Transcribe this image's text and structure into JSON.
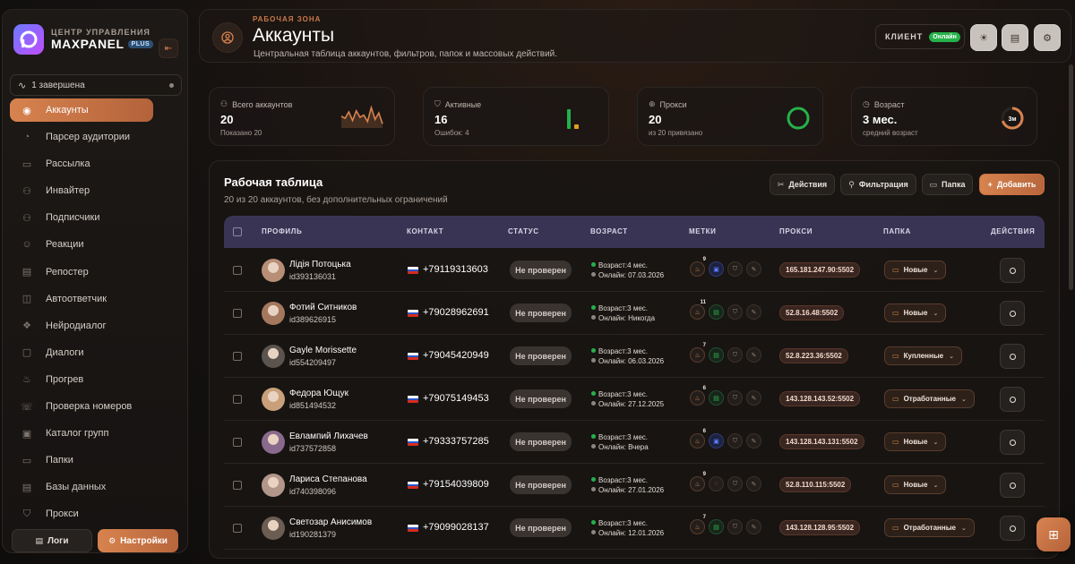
{
  "brand": {
    "subtitle": "ЦЕНТР УПРАВЛЕНИЯ",
    "name": "MAXPANEL",
    "plan": "PLUS"
  },
  "task_status": "1 завершена",
  "sidebar": {
    "items": [
      {
        "label": "Аккаунты",
        "icon": "user-icon",
        "active": true
      },
      {
        "label": "Парсер аудитории",
        "icon": "radar-icon"
      },
      {
        "label": "Рассылка",
        "icon": "mail-icon"
      },
      {
        "label": "Инвайтер",
        "icon": "user-plus-icon"
      },
      {
        "label": "Подписчики",
        "icon": "users-icon"
      },
      {
        "label": "Реакции",
        "icon": "smile-icon"
      },
      {
        "label": "Репостер",
        "icon": "repost-icon"
      },
      {
        "label": "Автоответчик",
        "icon": "bot-icon"
      },
      {
        "label": "Нейродиалог",
        "icon": "brain-icon"
      },
      {
        "label": "Диалоги",
        "icon": "chat-icon"
      },
      {
        "label": "Прогрев",
        "icon": "flame-icon"
      },
      {
        "label": "Проверка номеров",
        "icon": "phone-check-icon"
      },
      {
        "label": "Каталог групп",
        "icon": "catalog-icon"
      },
      {
        "label": "Папки",
        "icon": "folder-icon"
      },
      {
        "label": "Базы данных",
        "icon": "database-icon"
      },
      {
        "label": "Прокси",
        "icon": "shield-icon"
      }
    ],
    "logs_label": "Логи",
    "settings_label": "Настройки"
  },
  "header": {
    "eyebrow": "РАБОЧАЯ ЗОНА",
    "title": "Аккаунты",
    "subtitle": "Центральная таблица аккаунтов, фильтров, папок и массовых действий.",
    "client_label": "КЛИЕНТ",
    "online_label": "Онлайн"
  },
  "stats": [
    {
      "label": "Всего аккаунтов",
      "value": "20",
      "note": "Показано 20",
      "icon": "users-icon"
    },
    {
      "label": "Активные",
      "value": "16",
      "note": "Ошибок: 4",
      "icon": "shield-check-icon"
    },
    {
      "label": "Прокси",
      "value": "20",
      "note": "из 20 привязано",
      "icon": "globe-icon"
    },
    {
      "label": "Возраст",
      "value": "3 мес.",
      "note": "средний возраст",
      "icon": "clock-icon",
      "ring_label": "3м"
    }
  ],
  "stats_visuals": {
    "sparkline": [
      0.55,
      0.45,
      0.75,
      0.35,
      0.8,
      0.5,
      0.6,
      0.3,
      0.95,
      0.4,
      0.7,
      0.2
    ],
    "active_ratio": 0.8,
    "error_ratio": 0.2,
    "proxy_ratio": 1.0,
    "age_ratio": 0.7,
    "colors": {
      "accent": "#d7834f",
      "green": "#25b14a",
      "yellow": "#e0a21e"
    }
  },
  "table": {
    "title": "Рабочая таблица",
    "subtitle": "20 из 20 аккаунтов, без дополнительных ограничений",
    "buttons": {
      "actions": "Действия",
      "filter": "Фильтрация",
      "folder": "Папка",
      "add": "Добавить"
    },
    "columns": {
      "profile": "ПРОФИЛЬ",
      "contact": "КОНТАКТ",
      "status": "СТАТУС",
      "age": "ВОЗРАСТ",
      "tags": "МЕТКИ",
      "proxy": "ПРОКСИ",
      "folder": "ПАПКА",
      "actions": "ДЕЙСТВИЯ"
    },
    "rows": [
      {
        "name": "Лідія Потоцька",
        "id": "id393136031",
        "phone": "+79119313603",
        "status": "Не проверен",
        "age": "Возраст:4 мес.",
        "online": "Онлайн: 07.03.2026",
        "tag_count": "9",
        "second_tag": "bot",
        "proxy": "165.181.247.90:5502",
        "folder": "Новые",
        "avatar_color": "#b88f76"
      },
      {
        "name": "Фотий Ситников",
        "id": "id389626915",
        "phone": "+79028962691",
        "status": "Не проверен",
        "age": "Возраст:3 мес.",
        "online": "Онлайн: Никогда",
        "tag_count": "11",
        "second_tag": "green",
        "proxy": "52.8.16.48:5502",
        "folder": "Новые",
        "avatar_color": "#a4785e"
      },
      {
        "name": "Gayle Morissette",
        "id": "id554209497",
        "phone": "+79045420949",
        "status": "Не проверен",
        "age": "Возраст:3 мес.",
        "online": "Онлайн: 06.03.2026",
        "tag_count": "7",
        "second_tag": "green",
        "proxy": "52.8.223.36:5502",
        "folder": "Купленные",
        "avatar_color": "#5a534e"
      },
      {
        "name": "Федора Ющук",
        "id": "id851494532",
        "phone": "+79075149453",
        "status": "Не проверен",
        "age": "Возраст:3 мес.",
        "online": "Онлайн: 27.12.2025",
        "tag_count": "6",
        "second_tag": "green",
        "proxy": "143.128.143.52:5502",
        "folder": "Отработанные",
        "avatar_color": "#c9a07a"
      },
      {
        "name": "Евлампий Лихачев",
        "id": "id737572858",
        "phone": "+79333757285",
        "status": "Не проверен",
        "age": "Возраст:3 мес.",
        "online": "Онлайн: Вчера",
        "tag_count": "6",
        "second_tag": "bot",
        "proxy": "143.128.143.131:5502",
        "folder": "Новые",
        "avatar_color": "#8a6a8c"
      },
      {
        "name": "Лариса Степанова",
        "id": "id740398096",
        "phone": "+79154039809",
        "status": "Не проверен",
        "age": "Возраст:3 мес.",
        "online": "Онлайн: 27.01.2026",
        "tag_count": "9",
        "second_tag": "plain",
        "proxy": "52.8.110.115:5502",
        "folder": "Новые",
        "avatar_color": "#b3968a"
      },
      {
        "name": "Светозар Анисимов",
        "id": "id190281379",
        "phone": "+79099028137",
        "status": "Не проверен",
        "age": "Возраст:3 мес.",
        "online": "Онлайн: 12.01.2026",
        "tag_count": "7",
        "second_tag": "green",
        "proxy": "143.128.128.95:5502",
        "folder": "Отработанные",
        "avatar_color": "#6c5d52"
      }
    ]
  }
}
